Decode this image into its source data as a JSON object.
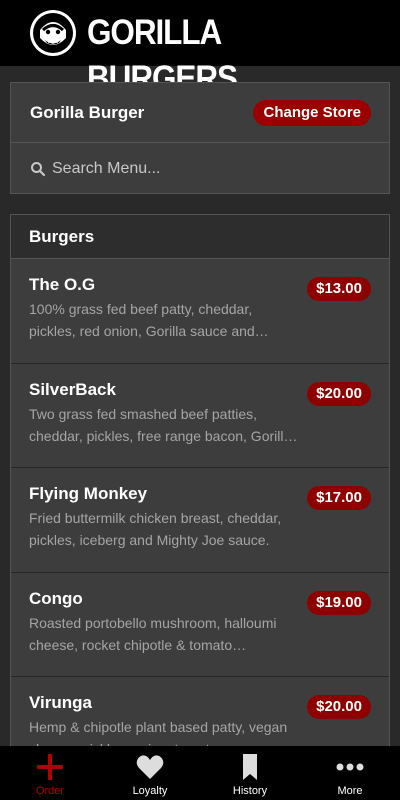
{
  "header": {
    "brand": "GORILLA BURGERS",
    "logo_icon": "gorilla-logo-icon"
  },
  "store": {
    "name": "Gorilla Burger",
    "change_label": "Change Store"
  },
  "search": {
    "placeholder": "Search Menu..."
  },
  "menu": {
    "section_title": "Burgers",
    "items": [
      {
        "name": "The O.G",
        "price": "$13.00",
        "desc": "100% grass fed beef patty, cheddar, pickles, red onion, Gorilla sauce and…"
      },
      {
        "name": "SilverBack",
        "price": "$20.00",
        "desc": "Two grass fed smashed beef patties, cheddar, pickles, free range bacon, Gorill…"
      },
      {
        "name": "Flying Monkey",
        "price": "$17.00",
        "desc": "Fried buttermilk chicken breast, cheddar, pickles, iceberg and Mighty Joe sauce."
      },
      {
        "name": "Congo",
        "price": "$19.00",
        "desc": "Roasted portobello mushroom, halloumi cheese, rocket chipotle & tomato…"
      },
      {
        "name": "Virunga",
        "price": "$20.00",
        "desc": "Hemp & chipotle plant based patty, vegan cheese, pickles, onion, tomato…"
      }
    ]
  },
  "tabs": [
    {
      "label": "Order",
      "icon": "plus-icon",
      "active": true
    },
    {
      "label": "Loyalty",
      "icon": "heart-icon",
      "active": false
    },
    {
      "label": "History",
      "icon": "bookmark-icon",
      "active": false
    },
    {
      "label": "More",
      "icon": "more-dots-icon",
      "active": false
    }
  ],
  "colors": {
    "accent": "#9b0000",
    "active_tab": "#b00000"
  }
}
